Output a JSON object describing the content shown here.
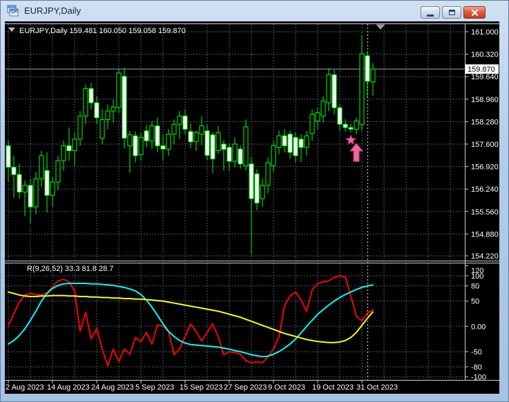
{
  "window": {
    "title": "EURJPY,Daily",
    "controls": {
      "minimize": "minimize",
      "restore": "restore",
      "close": "close"
    }
  },
  "chart": {
    "header_line": "EURJPY,Daily  159.481 160.050 159.058 159.870",
    "price_tag": "159.870",
    "price_axis": [
      {
        "label": "161.000",
        "value": 161.0
      },
      {
        "label": "160.320",
        "value": 160.32
      },
      {
        "label": "159.640",
        "value": 159.64
      },
      {
        "label": "158.960",
        "value": 158.96
      },
      {
        "label": "158.280",
        "value": 158.28
      },
      {
        "label": "157.600",
        "value": 157.6
      },
      {
        "label": "156.920",
        "value": 156.92
      },
      {
        "label": "156.240",
        "value": 156.24
      },
      {
        "label": "155.560",
        "value": 155.56
      },
      {
        "label": "154.880",
        "value": 154.88
      },
      {
        "label": "154.220",
        "value": 154.22
      }
    ],
    "time_axis": [
      {
        "label": "2 Aug 2023",
        "bar": 0
      },
      {
        "label": "14 Aug 2023",
        "bar": 8
      },
      {
        "label": "24 Aug 2023",
        "bar": 16
      },
      {
        "label": "5 Sep 2023",
        "bar": 24
      },
      {
        "label": "15 Sep 2023",
        "bar": 32
      },
      {
        "label": "27 Sep 2023",
        "bar": 40
      },
      {
        "label": "9 Oct 2023",
        "bar": 48
      },
      {
        "label": "19 Oct 2023",
        "bar": 56
      },
      {
        "label": "31 Oct 2023",
        "bar": 64
      }
    ],
    "indicator_label": "R(9,26,52) 33.3 81.8 28.7",
    "indicator_axis": [
      {
        "label": "120",
        "value": 120
      },
      {
        "label": "100",
        "value": 100
      },
      {
        "label": "80",
        "value": 80
      },
      {
        "label": "50",
        "value": 50
      },
      {
        "label": "0.00",
        "value": 0
      },
      {
        "label": "-50",
        "value": -50
      },
      {
        "label": "-80",
        "value": -80
      },
      {
        "label": "-100",
        "value": -100
      }
    ]
  },
  "colors": {
    "background": "#000000",
    "foreground": "#ffffff",
    "grid": "#4e5e6c",
    "frame": "#c8d2da",
    "candle": "#00ff00",
    "bull_fill": "#000000",
    "bear_fill": "#ffffff",
    "bid_line": "#9aa9b6",
    "separator": "#dfe6ec",
    "signal_pink": "#f4659d",
    "signal_pink_dark": "#cf3f7e",
    "shift_marker": "#9aa0a6",
    "indicator_red": "#ff0000",
    "indicator_cyan": "#00ffff",
    "indicator_yellow": "#ffff00"
  },
  "chart_data": [
    {
      "type": "candlestick",
      "symbol": "EURJPY",
      "timeframe": "Daily",
      "title": "EURJPY,Daily",
      "ylim": [
        154.22,
        161.0
      ],
      "current_bar": {
        "open": 159.481,
        "high": 160.05,
        "low": 159.058,
        "close": 159.87
      },
      "dates": [
        "2023-08-02",
        "2023-08-03",
        "2023-08-04",
        "2023-08-07",
        "2023-08-08",
        "2023-08-09",
        "2023-08-10",
        "2023-08-11",
        "2023-08-14",
        "2023-08-15",
        "2023-08-16",
        "2023-08-17",
        "2023-08-18",
        "2023-08-21",
        "2023-08-22",
        "2023-08-23",
        "2023-08-24",
        "2023-08-25",
        "2023-08-28",
        "2023-08-29",
        "2023-08-30",
        "2023-08-31",
        "2023-09-01",
        "2023-09-04",
        "2023-09-05",
        "2023-09-06",
        "2023-09-07",
        "2023-09-08",
        "2023-09-11",
        "2023-09-12",
        "2023-09-13",
        "2023-09-14",
        "2023-09-15",
        "2023-09-18",
        "2023-09-19",
        "2023-09-20",
        "2023-09-21",
        "2023-09-22",
        "2023-09-25",
        "2023-09-26",
        "2023-09-27",
        "2023-09-28",
        "2023-09-29",
        "2023-10-02",
        "2023-10-03",
        "2023-10-04",
        "2023-10-05",
        "2023-10-06",
        "2023-10-09",
        "2023-10-10",
        "2023-10-11",
        "2023-10-12",
        "2023-10-13",
        "2023-10-16",
        "2023-10-17",
        "2023-10-18",
        "2023-10-19",
        "2023-10-20",
        "2023-10-23",
        "2023-10-24",
        "2023-10-25",
        "2023-10-26",
        "2023-10-27",
        "2023-10-30",
        "2023-10-31",
        "2023-11-01",
        "2023-11-02"
      ],
      "open": [
        157.55,
        156.9,
        156.68,
        156.15,
        156.35,
        155.7,
        156.55,
        156.8,
        156.05,
        156.45,
        157.1,
        157.55,
        157.4,
        157.75,
        158.45,
        159.28,
        158.85,
        157.78,
        158.34,
        158.6,
        158.71,
        159.65,
        157.55,
        157.85,
        157.28,
        158.0,
        157.7,
        158.15,
        157.55,
        157.45,
        157.9,
        158.2,
        158.45,
        157.98,
        157.67,
        157.9,
        158.0,
        157.88,
        157.4,
        157.6,
        157.5,
        157.08,
        157.45,
        156.94,
        157.0,
        156.7,
        155.95,
        156.35,
        156.95,
        157.5,
        157.85,
        157.9,
        157.8,
        157.75,
        157.5,
        157.92,
        158.3,
        158.45,
        158.85,
        159.7,
        158.7,
        158.2,
        158.1,
        158.05,
        158.19,
        160.27,
        159.481
      ],
      "high": [
        157.72,
        157.25,
        157.0,
        156.5,
        156.55,
        156.75,
        157.4,
        157.35,
        156.6,
        157.25,
        157.7,
        158.1,
        157.95,
        158.6,
        159.4,
        159.45,
        159.05,
        158.65,
        158.8,
        158.95,
        159.88,
        159.92,
        158.0,
        157.98,
        157.95,
        158.18,
        158.3,
        158.4,
        157.9,
        158.05,
        158.35,
        158.6,
        158.65,
        158.23,
        158.0,
        158.44,
        158.19,
        157.96,
        158.15,
        157.72,
        157.62,
        157.8,
        157.55,
        158.35,
        157.2,
        156.85,
        156.55,
        157.2,
        157.7,
        158.0,
        158.05,
        158.0,
        157.95,
        157.9,
        158.0,
        158.65,
        158.7,
        159.05,
        159.9,
        159.85,
        158.82,
        158.35,
        158.22,
        158.4,
        160.9,
        160.4,
        160.05
      ],
      "low": [
        156.45,
        155.98,
        155.95,
        155.42,
        155.2,
        155.48,
        156.3,
        155.53,
        155.7,
        156.2,
        156.8,
        157.1,
        156.95,
        157.55,
        158.2,
        158.65,
        158.2,
        157.6,
        158.05,
        158.25,
        158.55,
        157.47,
        156.73,
        157.05,
        157.1,
        157.5,
        157.45,
        157.35,
        157.1,
        157.25,
        157.6,
        157.75,
        157.9,
        157.47,
        157.4,
        157.57,
        157.12,
        156.73,
        157.3,
        156.8,
        156.79,
        156.9,
        156.85,
        156.8,
        154.25,
        155.6,
        155.7,
        156.1,
        156.75,
        157.3,
        157.35,
        157.15,
        157.05,
        157.05,
        157.25,
        157.7,
        158.05,
        158.25,
        158.6,
        158.5,
        158.0,
        157.98,
        157.95,
        157.9,
        158.0,
        159.0,
        159.058
      ],
      "close": [
        156.9,
        156.68,
        156.15,
        156.35,
        155.7,
        156.55,
        157.25,
        156.05,
        156.45,
        157.1,
        157.55,
        157.4,
        157.75,
        158.45,
        159.28,
        158.85,
        158.4,
        158.34,
        158.6,
        158.72,
        159.75,
        157.78,
        157.88,
        157.25,
        157.8,
        157.7,
        158.15,
        157.55,
        157.45,
        157.9,
        158.2,
        158.45,
        158.05,
        157.67,
        157.95,
        158.15,
        157.26,
        157.15,
        157.94,
        157.44,
        157.08,
        157.6,
        157.0,
        158.12,
        155.95,
        155.82,
        156.35,
        157.04,
        157.55,
        157.85,
        157.55,
        157.35,
        157.25,
        157.5,
        157.85,
        158.5,
        158.55,
        158.9,
        159.7,
        158.7,
        158.2,
        158.1,
        158.05,
        158.3,
        160.33,
        159.5,
        159.87
      ],
      "signals": [
        {
          "shape": "star",
          "date": "2023-10-27",
          "price": 157.72
        },
        {
          "shape": "arrow-up",
          "date": "2023-10-30",
          "price": 157.62
        }
      ]
    },
    {
      "type": "line",
      "panel": "oscillator",
      "label": "R(9,26,52) 33.3 81.8 28.7",
      "current_values": [
        33.3,
        81.8,
        28.7
      ],
      "ylim": [
        -106,
        123
      ],
      "levels": [
        100,
        80,
        50,
        0,
        -50,
        -80,
        -100
      ],
      "series": [
        {
          "name": "fast",
          "color": "#ff0000",
          "values": [
            2,
            25,
            48,
            62,
            65,
            63,
            62,
            66,
            78,
            90,
            93,
            88,
            70,
            -10,
            28,
            -25,
            -4,
            -45,
            -78,
            -45,
            -70,
            -45,
            -55,
            -22,
            -30,
            -12,
            -35,
            3,
            1,
            -10,
            -56,
            -45,
            -20,
            5,
            -10,
            -29,
            -12,
            5,
            -20,
            -56,
            -50,
            -52,
            -55,
            -68,
            -72,
            -70,
            -72,
            -60,
            -45,
            -20,
            41,
            60,
            68,
            52,
            30,
            72,
            85,
            88,
            90,
            97,
            100,
            98,
            60,
            20,
            11,
            26,
            33.3
          ]
        },
        {
          "name": "signal",
          "color": "#00ffff",
          "values": [
            -35,
            -28,
            -18,
            -5,
            12,
            30,
            50,
            65,
            75,
            81,
            84,
            85,
            85,
            85,
            85,
            84,
            84,
            83,
            82,
            81,
            79,
            77,
            74,
            70,
            63,
            52,
            38,
            22,
            5,
            -10,
            -20,
            -28,
            -33,
            -36,
            -37,
            -38,
            -39,
            -40,
            -41,
            -43,
            -45,
            -48,
            -50,
            -53,
            -56,
            -58,
            -60,
            -59,
            -55,
            -50,
            -43,
            -35,
            -25,
            -13,
            0,
            12,
            24,
            33,
            42,
            50,
            57,
            63,
            68,
            73,
            77,
            80,
            81.8
          ]
        },
        {
          "name": "slow",
          "color": "#ffff00",
          "values": [
            68,
            65,
            62,
            60,
            59,
            59,
            60,
            60,
            61,
            61,
            61,
            60,
            60,
            59,
            59,
            58,
            58,
            57,
            57,
            56,
            56,
            55,
            55,
            54,
            54,
            53,
            52,
            51,
            50,
            48,
            46,
            44,
            42,
            40,
            38,
            36,
            34,
            32,
            30,
            27,
            24,
            21,
            18,
            14,
            10,
            6,
            2,
            -2,
            -6,
            -10,
            -14,
            -17,
            -20,
            -23,
            -26,
            -28,
            -30,
            -31,
            -32,
            -32,
            -31,
            -28,
            -22,
            -12,
            2,
            16,
            28.7
          ]
        }
      ]
    }
  ]
}
